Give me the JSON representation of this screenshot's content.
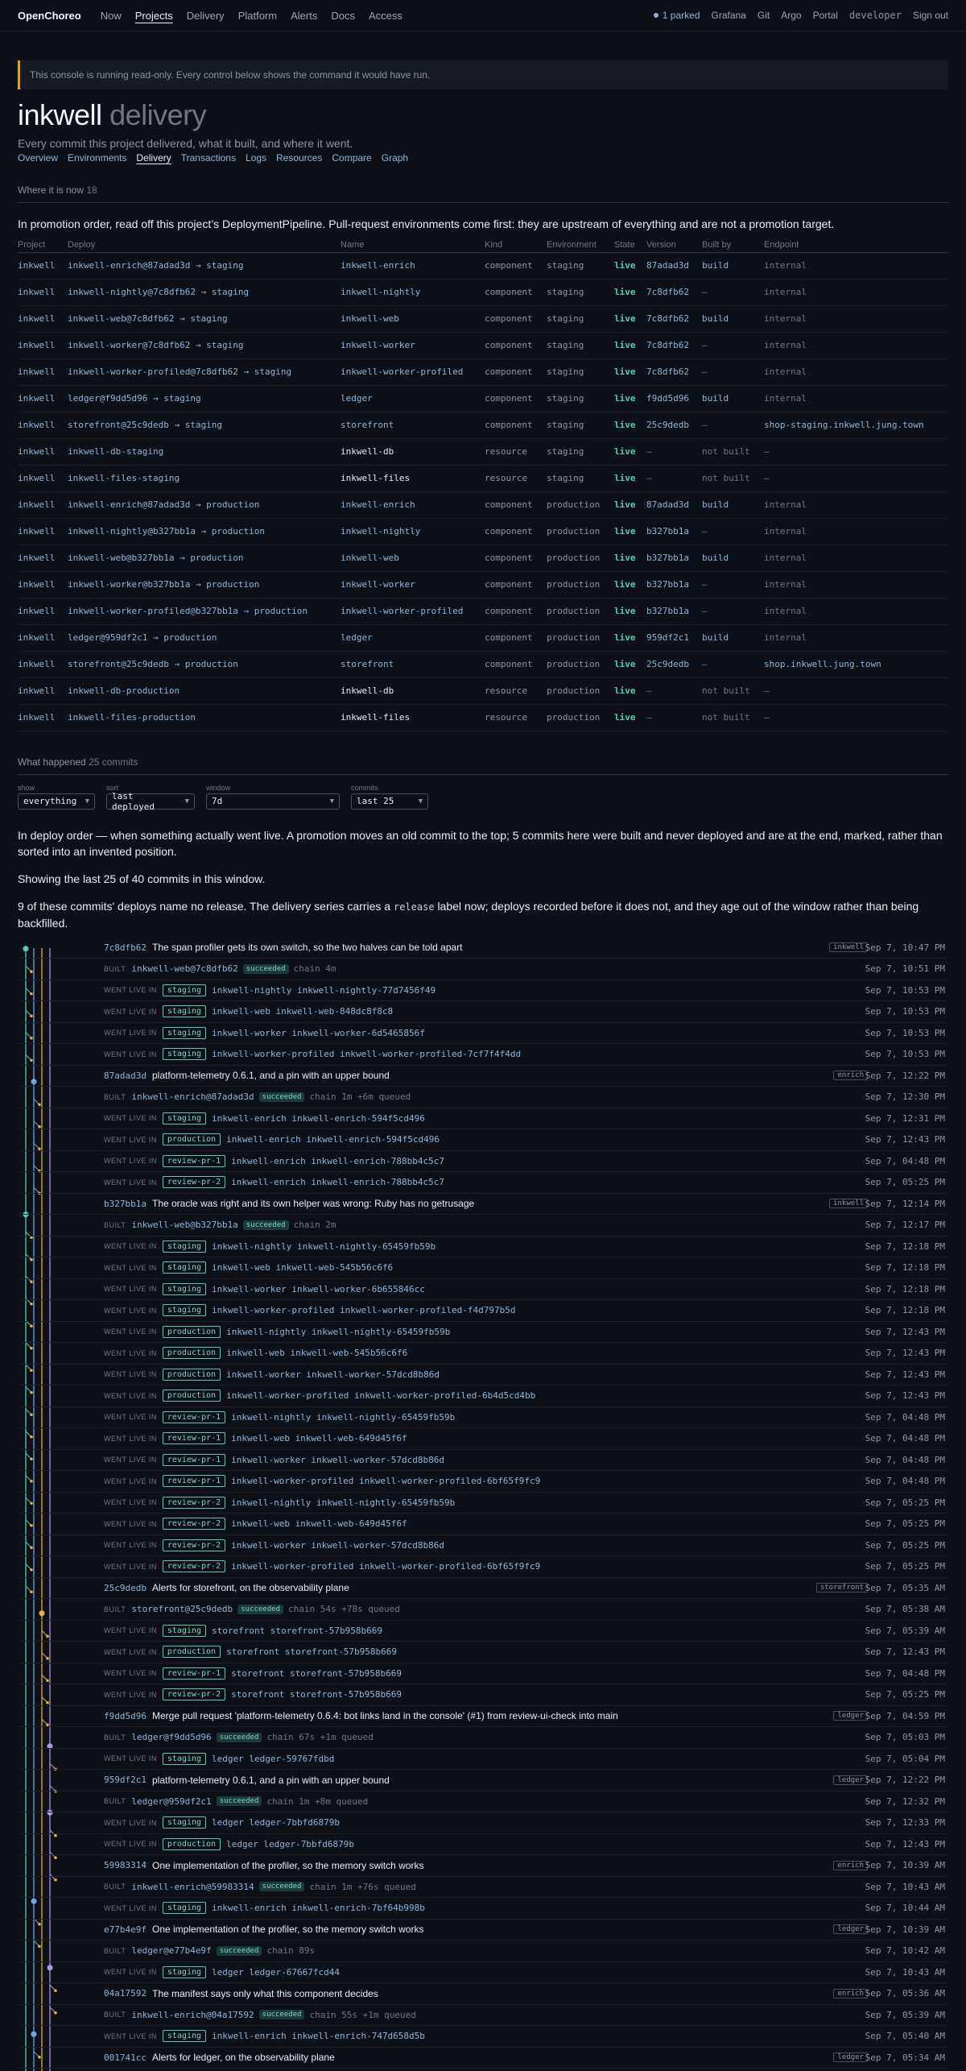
{
  "nav": {
    "brand": "OpenChoreo",
    "links": [
      "Now",
      "Projects",
      "Delivery",
      "Platform",
      "Alerts",
      "Docs",
      "Access"
    ],
    "active": "Projects",
    "parked": "1 parked",
    "right_links": [
      "Grafana",
      "Git",
      "Argo",
      "Portal"
    ],
    "user": "developer",
    "signout": "Sign out"
  },
  "banner": "This console is running read-only. Every control below shows the command it would have run.",
  "page": {
    "title": "inkwell",
    "title_sub": "delivery",
    "tagline": "Every commit this project delivered, what it built, and where it went.",
    "tabs": [
      "Overview",
      "Environments",
      "Delivery",
      "Transactions",
      "Logs",
      "Resources",
      "Compare",
      "Graph"
    ],
    "active_tab": "Delivery"
  },
  "now": {
    "heading": "Where it is now",
    "count": "18",
    "intro": "In promotion order, read off this project’s DeploymentPipeline. Pull-request environments come first: they are upstream of everything and are not a promotion target.",
    "columns": [
      "Project",
      "Deploy",
      "Name",
      "Kind",
      "Environment",
      "State",
      "Version",
      "Built by",
      "Endpoint"
    ],
    "rows": [
      [
        "inkwell",
        "inkwell-enrich@87adad3d → staging",
        "inkwell-enrich",
        "component",
        "staging",
        "live",
        "87adad3d",
        "build",
        "internal"
      ],
      [
        "inkwell",
        "inkwell-nightly@7c8dfb62 → staging",
        "inkwell-nightly",
        "component",
        "staging",
        "live",
        "7c8dfb62",
        "—",
        "internal"
      ],
      [
        "inkwell",
        "inkwell-web@7c8dfb62 → staging",
        "inkwell-web",
        "component",
        "staging",
        "live",
        "7c8dfb62",
        "build",
        "internal"
      ],
      [
        "inkwell",
        "inkwell-worker@7c8dfb62 → staging",
        "inkwell-worker",
        "component",
        "staging",
        "live",
        "7c8dfb62",
        "—",
        "internal"
      ],
      [
        "inkwell",
        "inkwell-worker-profiled@7c8dfb62 → staging",
        "inkwell-worker-profiled",
        "component",
        "staging",
        "live",
        "7c8dfb62",
        "—",
        "internal"
      ],
      [
        "inkwell",
        "ledger@f9dd5d96 → staging",
        "ledger",
        "component",
        "staging",
        "live",
        "f9dd5d96",
        "build",
        "internal"
      ],
      [
        "inkwell",
        "storefront@25c9dedb → staging",
        "storefront",
        "component",
        "staging",
        "live",
        "25c9dedb",
        "—",
        "shop-staging.inkwell.jung.town"
      ],
      [
        "inkwell",
        "inkwell-db-staging",
        "inkwell-db",
        "resource",
        "staging",
        "live",
        "—",
        "not built",
        "—"
      ],
      [
        "inkwell",
        "inkwell-files-staging",
        "inkwell-files",
        "resource",
        "staging",
        "live",
        "—",
        "not built",
        "—"
      ],
      [
        "inkwell",
        "inkwell-enrich@87adad3d → production",
        "inkwell-enrich",
        "component",
        "production",
        "live",
        "87adad3d",
        "build",
        "internal"
      ],
      [
        "inkwell",
        "inkwell-nightly@b327bb1a → production",
        "inkwell-nightly",
        "component",
        "production",
        "live",
        "b327bb1a",
        "—",
        "internal"
      ],
      [
        "inkwell",
        "inkwell-web@b327bb1a → production",
        "inkwell-web",
        "component",
        "production",
        "live",
        "b327bb1a",
        "build",
        "internal"
      ],
      [
        "inkwell",
        "inkwell-worker@b327bb1a → production",
        "inkwell-worker",
        "component",
        "production",
        "live",
        "b327bb1a",
        "—",
        "internal"
      ],
      [
        "inkwell",
        "inkwell-worker-profiled@b327bb1a → production",
        "inkwell-worker-profiled",
        "component",
        "production",
        "live",
        "b327bb1a",
        "—",
        "internal"
      ],
      [
        "inkwell",
        "ledger@959df2c1 → production",
        "ledger",
        "component",
        "production",
        "live",
        "959df2c1",
        "build",
        "internal"
      ],
      [
        "inkwell",
        "storefront@25c9dedb → production",
        "storefront",
        "component",
        "production",
        "live",
        "25c9dedb",
        "—",
        "shop.inkwell.jung.town"
      ],
      [
        "inkwell",
        "inkwell-db-production",
        "inkwell-db",
        "resource",
        "production",
        "live",
        "—",
        "not built",
        "—"
      ],
      [
        "inkwell",
        "inkwell-files-production",
        "inkwell-files",
        "resource",
        "production",
        "live",
        "—",
        "not built",
        "—"
      ]
    ]
  },
  "history": {
    "heading": "What happened",
    "count": "25 commits",
    "filters": [
      {
        "label": "show",
        "value": "everything"
      },
      {
        "label": "sort",
        "value": "last deployed"
      },
      {
        "label": "window",
        "value": "7d"
      },
      {
        "label": "commits",
        "value": "last 25"
      }
    ],
    "p1": "In deploy order — when something actually went live. A promotion moves an old commit to the top; 5 commits here were built and never deployed and are at the end, marked, rather than sorted into an invented position.",
    "p2": "Showing the last 25 of 40 commits in this window.",
    "p3_a": "9 of these commits' deploys name no release. The delivery series carries a",
    "p3_code": "release",
    "p3_b": "label now; deploys recorded before it does not, and they age out of the window rather than being backfilled.",
    "built_label": "BUILT",
    "live_label": "WENT LIVE IN",
    "succeeded": "succeeded",
    "rows": [
      {
        "t": "commit",
        "sha": "7c8dfb62",
        "msg": "The span profiler gets its own switch, so the two halves can be told apart",
        "tag": "inkwell",
        "time": "Sep 7, 10:47 PM"
      },
      {
        "t": "built",
        "ref": "inkwell-web@7c8dfb62",
        "chain": "chain 4m",
        "time": "Sep 7, 10:51 PM"
      },
      {
        "t": "live",
        "env": "staging",
        "comp": "inkwell-nightly inkwell-nightly-77d7456f49",
        "time": "Sep 7, 10:53 PM"
      },
      {
        "t": "live",
        "env": "staging",
        "comp": "inkwell-web inkwell-web-848dc8f8c8",
        "time": "Sep 7, 10:53 PM"
      },
      {
        "t": "live",
        "env": "staging",
        "comp": "inkwell-worker inkwell-worker-6d5465856f",
        "time": "Sep 7, 10:53 PM"
      },
      {
        "t": "live",
        "env": "staging",
        "comp": "inkwell-worker-profiled inkwell-worker-profiled-7cf7f4f4dd",
        "time": "Sep 7, 10:53 PM"
      },
      {
        "t": "commit",
        "sha": "87adad3d",
        "msg": "platform-telemetry 0.6.1, and a pin with an upper bound",
        "tag": "enrich",
        "time": "Sep 7, 12:22 PM"
      },
      {
        "t": "built",
        "ref": "inkwell-enrich@87adad3d",
        "chain": "chain 1m +6m queued",
        "time": "Sep 7, 12:30 PM"
      },
      {
        "t": "live",
        "env": "staging",
        "comp": "inkwell-enrich inkwell-enrich-594f5cd496",
        "time": "Sep 7, 12:31 PM"
      },
      {
        "t": "live",
        "env": "production",
        "comp": "inkwell-enrich inkwell-enrich-594f5cd496",
        "time": "Sep 7, 12:43 PM"
      },
      {
        "t": "live",
        "env": "review-pr-1",
        "comp": "inkwell-enrich inkwell-enrich-788bb4c5c7",
        "time": "Sep 7, 04:48 PM"
      },
      {
        "t": "live",
        "env": "review-pr-2",
        "comp": "inkwell-enrich inkwell-enrich-788bb4c5c7",
        "time": "Sep 7, 05:25 PM"
      },
      {
        "t": "commit",
        "sha": "b327bb1a",
        "msg": "The oracle was right and its own helper was wrong: Ruby has no getrusage",
        "tag": "inkwell",
        "time": "Sep 7, 12:14 PM"
      },
      {
        "t": "built",
        "ref": "inkwell-web@b327bb1a",
        "chain": "chain 2m",
        "time": "Sep 7, 12:17 PM"
      },
      {
        "t": "live",
        "env": "staging",
        "comp": "inkwell-nightly inkwell-nightly-65459fb59b",
        "time": "Sep 7, 12:18 PM"
      },
      {
        "t": "live",
        "env": "staging",
        "comp": "inkwell-web inkwell-web-545b56c6f6",
        "time": "Sep 7, 12:18 PM"
      },
      {
        "t": "live",
        "env": "staging",
        "comp": "inkwell-worker inkwell-worker-6b655846cc",
        "time": "Sep 7, 12:18 PM"
      },
      {
        "t": "live",
        "env": "staging",
        "comp": "inkwell-worker-profiled inkwell-worker-profiled-f4d797b5d",
        "time": "Sep 7, 12:18 PM"
      },
      {
        "t": "live",
        "env": "production",
        "comp": "inkwell-nightly inkwell-nightly-65459fb59b",
        "time": "Sep 7, 12:43 PM"
      },
      {
        "t": "live",
        "env": "production",
        "comp": "inkwell-web inkwell-web-545b56c6f6",
        "time": "Sep 7, 12:43 PM"
      },
      {
        "t": "live",
        "env": "production",
        "comp": "inkwell-worker inkwell-worker-57dcd8b86d",
        "time": "Sep 7, 12:43 PM"
      },
      {
        "t": "live",
        "env": "production",
        "comp": "inkwell-worker-profiled inkwell-worker-profiled-6b4d5cd4bb",
        "time": "Sep 7, 12:43 PM"
      },
      {
        "t": "live",
        "env": "review-pr-1",
        "comp": "inkwell-nightly inkwell-nightly-65459fb59b",
        "time": "Sep 7, 04:48 PM"
      },
      {
        "t": "live",
        "env": "review-pr-1",
        "comp": "inkwell-web inkwell-web-649d45f6f",
        "time": "Sep 7, 04:48 PM"
      },
      {
        "t": "live",
        "env": "review-pr-1",
        "comp": "inkwell-worker inkwell-worker-57dcd8b86d",
        "time": "Sep 7, 04:48 PM"
      },
      {
        "t": "live",
        "env": "review-pr-1",
        "comp": "inkwell-worker-profiled inkwell-worker-profiled-6bf65f9fc9",
        "time": "Sep 7, 04:48 PM"
      },
      {
        "t": "live",
        "env": "review-pr-2",
        "comp": "inkwell-nightly inkwell-nightly-65459fb59b",
        "time": "Sep 7, 05:25 PM"
      },
      {
        "t": "live",
        "env": "review-pr-2",
        "comp": "inkwell-web inkwell-web-649d45f6f",
        "time": "Sep 7, 05:25 PM"
      },
      {
        "t": "live",
        "env": "review-pr-2",
        "comp": "inkwell-worker inkwell-worker-57dcd8b86d",
        "time": "Sep 7, 05:25 PM"
      },
      {
        "t": "live",
        "env": "review-pr-2",
        "comp": "inkwell-worker-profiled inkwell-worker-profiled-6bf65f9fc9",
        "time": "Sep 7, 05:25 PM"
      },
      {
        "t": "commit",
        "sha": "25c9dedb",
        "msg": "Alerts for storefront, on the observability plane",
        "tag": "storefront",
        "time": "Sep 7, 05:35 AM"
      },
      {
        "t": "built",
        "ref": "storefront@25c9dedb",
        "chain": "chain 54s +78s queued",
        "time": "Sep 7, 05:38 AM"
      },
      {
        "t": "live",
        "env": "staging",
        "comp": "storefront storefront-57b958b669",
        "time": "Sep 7, 05:39 AM"
      },
      {
        "t": "live",
        "env": "production",
        "comp": "storefront storefront-57b958b669",
        "time": "Sep 7, 12:43 PM"
      },
      {
        "t": "live",
        "env": "review-pr-1",
        "comp": "storefront storefront-57b958b669",
        "time": "Sep 7, 04:48 PM"
      },
      {
        "t": "live",
        "env": "review-pr-2",
        "comp": "storefront storefront-57b958b669",
        "time": "Sep 7, 05:25 PM"
      },
      {
        "t": "commit",
        "sha": "f9dd5d96",
        "msg": "Merge pull request 'platform-telemetry 0.6.4: bot links land in the console' (#1) from review-ui-check into main",
        "tag": "ledger",
        "time": "Sep 7, 04:59 PM"
      },
      {
        "t": "built",
        "ref": "ledger@f9dd5d96",
        "chain": "chain 67s +1m queued",
        "time": "Sep 7, 05:03 PM"
      },
      {
        "t": "live",
        "env": "staging",
        "comp": "ledger ledger-59767fdbd",
        "time": "Sep 7, 05:04 PM"
      },
      {
        "t": "commit",
        "sha": "959df2c1",
        "msg": "platform-telemetry 0.6.1, and a pin with an upper bound",
        "tag": "ledger",
        "time": "Sep 7, 12:22 PM"
      },
      {
        "t": "built",
        "ref": "ledger@959df2c1",
        "chain": "chain 1m +8m queued",
        "time": "Sep 7, 12:32 PM"
      },
      {
        "t": "live",
        "env": "staging",
        "comp": "ledger ledger-7bbfd6879b",
        "time": "Sep 7, 12:33 PM"
      },
      {
        "t": "live",
        "env": "production",
        "comp": "ledger ledger-7bbfd6879b",
        "time": "Sep 7, 12:43 PM"
      },
      {
        "t": "commit",
        "sha": "59983314",
        "msg": "One implementation of the profiler, so the memory switch works",
        "tag": "enrich",
        "time": "Sep 7, 10:39 AM"
      },
      {
        "t": "built",
        "ref": "inkwell-enrich@59983314",
        "chain": "chain 1m +76s queued",
        "time": "Sep 7, 10:43 AM"
      },
      {
        "t": "live",
        "env": "staging",
        "comp": "inkwell-enrich inkwell-enrich-7bf64b998b",
        "time": "Sep 7, 10:44 AM"
      },
      {
        "t": "commit",
        "sha": "e77b4e9f",
        "msg": "One implementation of the profiler, so the memory switch works",
        "tag": "ledger",
        "time": "Sep 7, 10:39 AM"
      },
      {
        "t": "built",
        "ref": "ledger@e77b4e9f",
        "chain": "chain 89s",
        "time": "Sep 7, 10:42 AM"
      },
      {
        "t": "live",
        "env": "staging",
        "comp": "ledger ledger-67667fcd44",
        "time": "Sep 7, 10:43 AM"
      },
      {
        "t": "commit",
        "sha": "04a17592",
        "msg": "The manifest says only what this component decides",
        "tag": "enrich",
        "time": "Sep 7, 05:36 AM"
      },
      {
        "t": "built",
        "ref": "inkwell-enrich@04a17592",
        "chain": "chain 55s +1m queued",
        "time": "Sep 7, 05:39 AM"
      },
      {
        "t": "live",
        "env": "staging",
        "comp": "inkwell-enrich inkwell-enrich-747d658d5b",
        "time": "Sep 7, 05:40 AM"
      },
      {
        "t": "commit",
        "sha": "001741cc",
        "msg": "Alerts for ledger, on the observability plane",
        "tag": "ledger",
        "time": "Sep 7, 05:34 AM"
      }
    ]
  },
  "colors": {
    "lane_inkwell": "#5cc9b5",
    "lane_enrich": "#6fa8dc",
    "lane_storefront": "#e3b341",
    "lane_ledger": "#b392f0"
  }
}
